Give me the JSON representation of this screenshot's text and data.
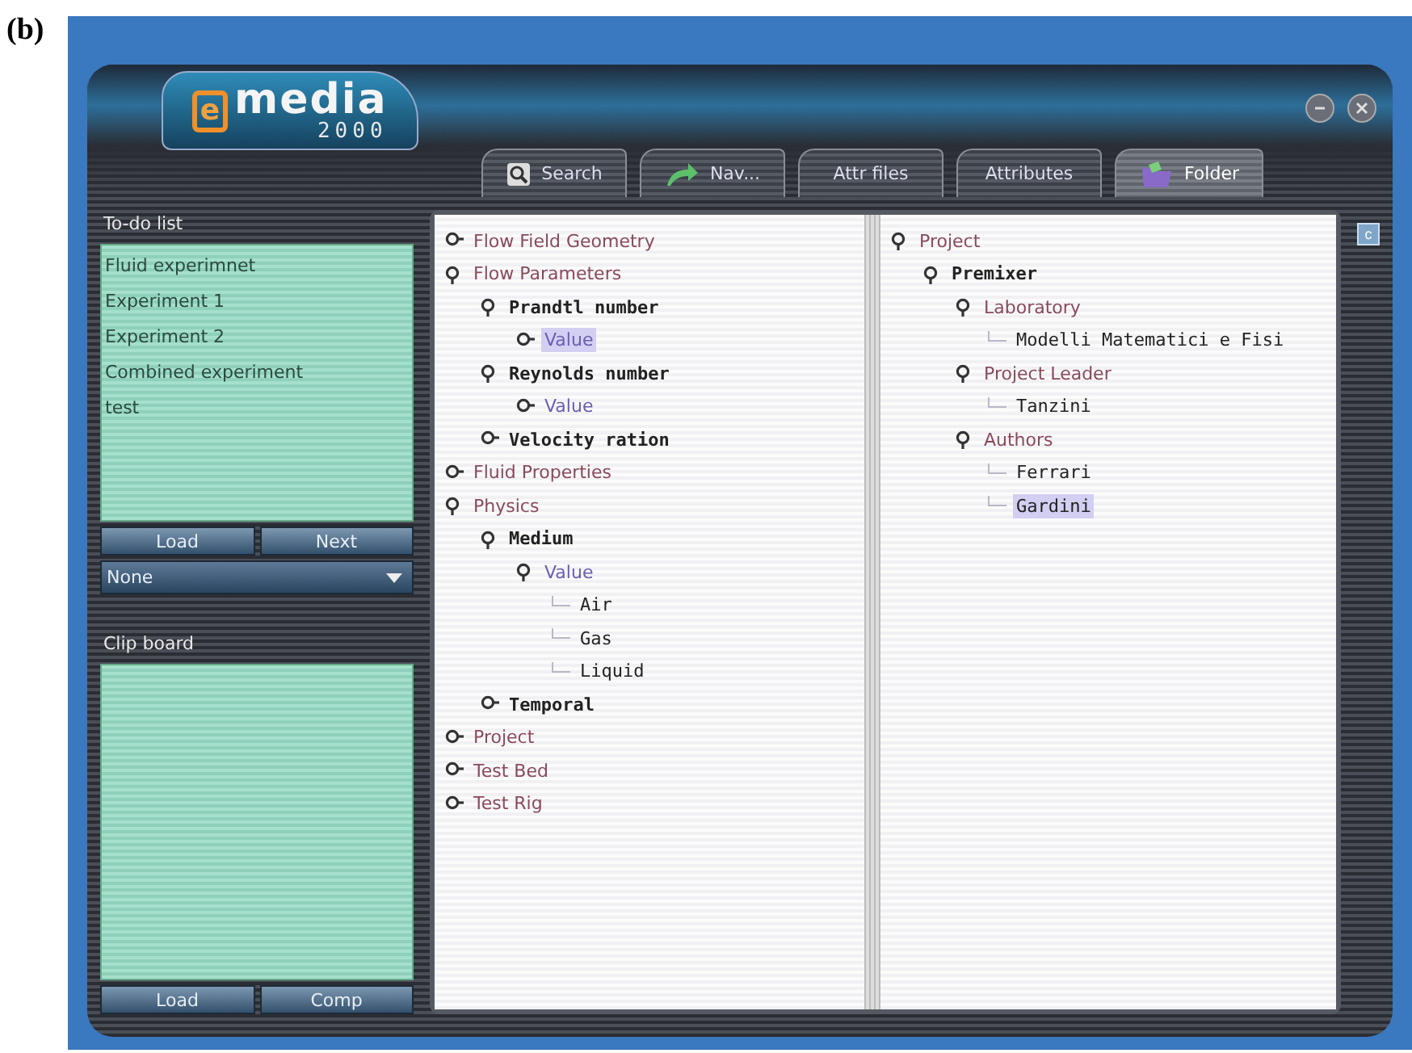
{
  "figure_label": "(b)",
  "logo": {
    "mark": "e",
    "name": "media",
    "version": "2000"
  },
  "tabs": [
    {
      "label": "Search",
      "kind": "search",
      "selected": false
    },
    {
      "label": "Nav...",
      "kind": "arrow",
      "selected": false
    },
    {
      "label": "Attr files",
      "selected": false
    },
    {
      "label": "Attributes",
      "selected": false
    },
    {
      "label": "Folder",
      "kind": "folder",
      "selected": true
    }
  ],
  "todo": {
    "title": "To-do list",
    "items": [
      "Fluid experimnet",
      "Experiment 1",
      "Experiment 2",
      "Combined experiment",
      "test"
    ],
    "buttons": [
      "Load",
      "Next"
    ],
    "dropdown": "None"
  },
  "clipboard": {
    "title": "Clip board",
    "buttons": [
      "Load",
      "Comp"
    ]
  },
  "left_tree": [
    {
      "label": "Flow Field Geometry",
      "kind": "category",
      "expanded": false,
      "selected": false
    },
    {
      "label": "Flow Parameters",
      "kind": "category",
      "expanded": true,
      "selected": false,
      "children": [
        {
          "label": "Prandtl number",
          "kind": "field",
          "expanded": true,
          "selected": false,
          "children": [
            {
              "label": "Value",
              "kind": "value",
              "expanded": false,
              "selected": true
            }
          ]
        },
        {
          "label": "Reynolds number",
          "kind": "field",
          "expanded": true,
          "selected": false,
          "children": [
            {
              "label": "Value",
              "kind": "value",
              "expanded": false,
              "selected": false
            }
          ]
        },
        {
          "label": "Velocity ration",
          "kind": "field",
          "expanded": false,
          "selected": false
        }
      ]
    },
    {
      "label": "Fluid Properties",
      "kind": "category",
      "expanded": false,
      "selected": false
    },
    {
      "label": "Physics",
      "kind": "category",
      "expanded": true,
      "selected": false,
      "children": [
        {
          "label": "Medium",
          "kind": "field",
          "expanded": true,
          "selected": false,
          "children": [
            {
              "label": "Value",
              "kind": "value",
              "expanded": true,
              "selected": false,
              "children": [
                {
                  "label": "Air",
                  "kind": "leaf",
                  "selected": false
                },
                {
                  "label": "Gas",
                  "kind": "leaf",
                  "selected": false
                },
                {
                  "label": "Liquid",
                  "kind": "leaf",
                  "selected": false
                }
              ]
            }
          ]
        },
        {
          "label": "Temporal",
          "kind": "field",
          "expanded": false,
          "selected": false
        }
      ]
    },
    {
      "label": "Project",
      "kind": "category",
      "expanded": false,
      "selected": false
    },
    {
      "label": "Test Bed",
      "kind": "category",
      "expanded": false,
      "selected": false
    },
    {
      "label": "Test Rig",
      "kind": "category",
      "expanded": false,
      "selected": false
    }
  ],
  "right_tree": [
    {
      "label": "Project",
      "kind": "category",
      "expanded": true,
      "selected": false,
      "children": [
        {
          "label": "Premixer",
          "kind": "field",
          "expanded": true,
          "selected": false,
          "children": [
            {
              "label": "Laboratory",
              "kind": "category",
              "expanded": true,
              "selected": false,
              "children": [
                {
                  "label": "Modelli Matematici e Fisi",
                  "kind": "leaf",
                  "selected": false
                }
              ]
            },
            {
              "label": "Project Leader",
              "kind": "category",
              "expanded": true,
              "selected": false,
              "children": [
                {
                  "label": "Tanzini",
                  "kind": "leaf",
                  "selected": false
                }
              ]
            },
            {
              "label": "Authors",
              "kind": "category",
              "expanded": true,
              "selected": false,
              "children": [
                {
                  "label": "Ferrari",
                  "kind": "leaf",
                  "selected": false
                },
                {
                  "label": "Gardini",
                  "kind": "leaf",
                  "selected": true
                }
              ]
            }
          ]
        }
      ]
    }
  ],
  "side_button": "c"
}
